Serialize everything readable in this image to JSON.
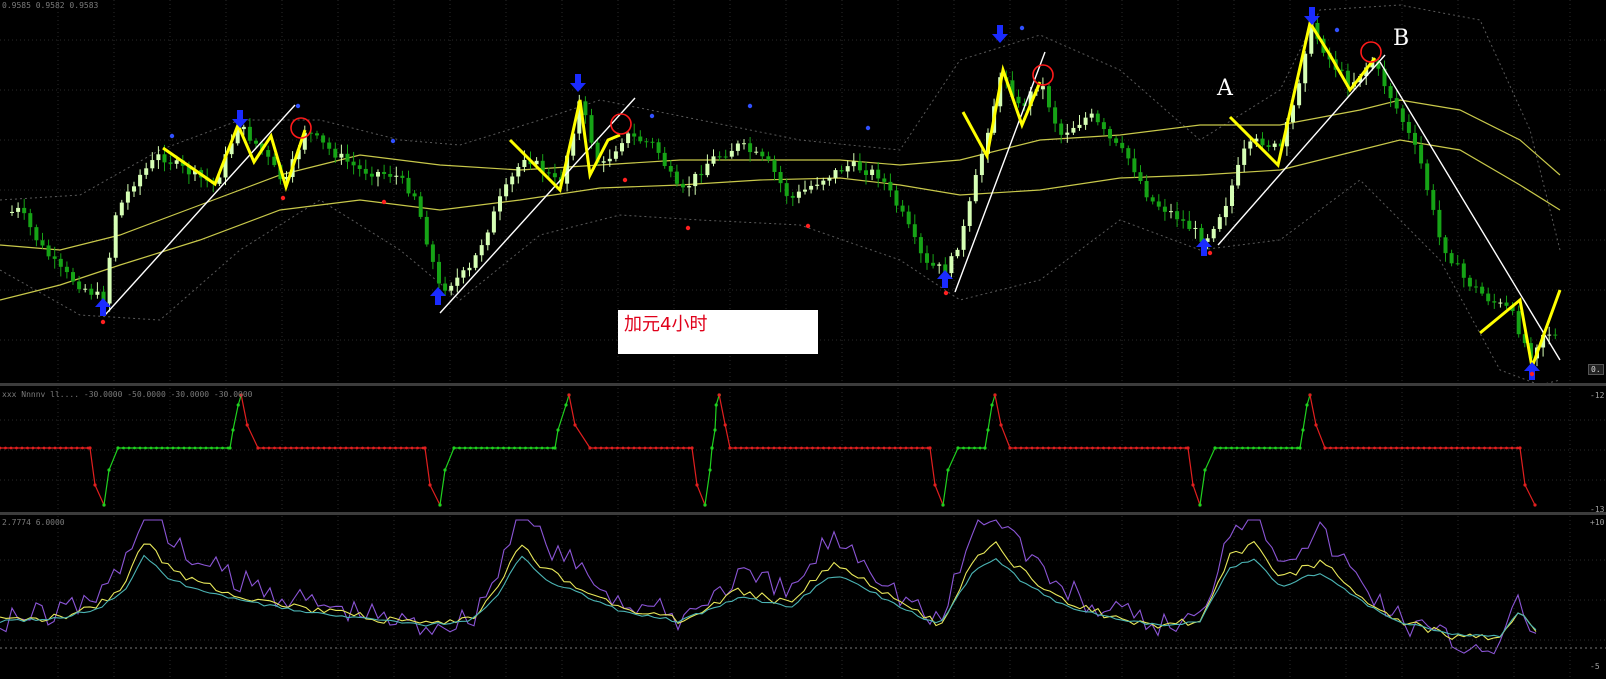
{
  "window": {
    "main_pane_info": "0.9585 0.9582 0.9583",
    "indicator1_info": "xxx Nnnnv ll.... -30.0000 -50.0000 -30.0000 -30.0000",
    "indicator2_info": "2.7774 6.0000"
  },
  "annotations": {
    "title_box": "加元4小时",
    "label_a": "A",
    "label_b": "B"
  },
  "axis": {
    "oscillator_top": "-12",
    "oscillator_bottom": "-13",
    "lower_top": "+10",
    "lower_bottom": "-5",
    "price_tag": "0."
  },
  "colors": {
    "background": "#000000",
    "grid": "#2a2a2a",
    "bull_candle": "#d6ffb5",
    "bear_candle": "#16a316",
    "moving_average": "#c8c84a",
    "bollinger": "#5a5a5a",
    "zigzag": "#ffff00",
    "trendline": "#ffffff",
    "arrow": "#1a2bff",
    "circle": "#ff1a1a",
    "osc_up": "#1fd01f",
    "osc_down": "#e01f1f",
    "line_purple": "#8b55d6",
    "line_yellow": "#e8e85a",
    "line_cyan": "#4bb4b4"
  },
  "markers": {
    "arrow_up_icon": "up-arrow-icon",
    "arrow_down_icon": "down-arrow-icon",
    "circle_icon": "circle-marker-icon"
  }
}
